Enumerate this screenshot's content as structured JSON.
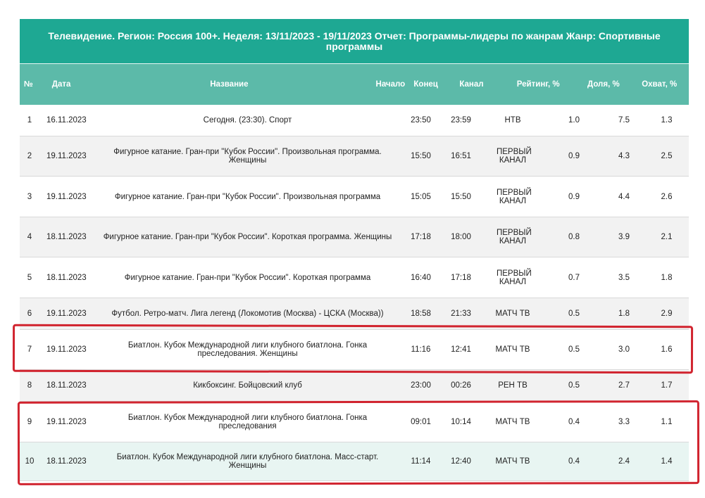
{
  "report": {
    "title": "Телевидение. Регион: Россия 100+. Неделя: 13/11/2023 - 19/11/2023 Отчет: Программы-лидеры по жанрам Жанр: Спортивные программы"
  },
  "columns": {
    "num": "№",
    "date": "Дата",
    "name": "Название",
    "start": "Начало",
    "end": "Конец",
    "channel": "Канал",
    "rating": "Рейтинг, %",
    "share": "Доля, %",
    "reach": "Охват, %"
  },
  "rows": [
    {
      "num": "1",
      "date": "16.11.2023",
      "name": "Сегодня. (23:30). Спорт",
      "start": "23:50",
      "end": "23:59",
      "channel": "НТВ",
      "rating": "1.0",
      "share": "7.5",
      "reach": "1.3"
    },
    {
      "num": "2",
      "date": "19.11.2023",
      "name": "Фигурное катание. Гран-при \"Кубок России\". Произвольная программа. Женщины",
      "start": "15:50",
      "end": "16:51",
      "channel": "ПЕРВЫЙ КАНАЛ",
      "rating": "0.9",
      "share": "4.3",
      "reach": "2.5"
    },
    {
      "num": "3",
      "date": "19.11.2023",
      "name": "Фигурное катание. Гран-при \"Кубок России\". Произвольная программа",
      "start": "15:05",
      "end": "15:50",
      "channel": "ПЕРВЫЙ КАНАЛ",
      "rating": "0.9",
      "share": "4.4",
      "reach": "2.6"
    },
    {
      "num": "4",
      "date": "18.11.2023",
      "name": "Фигурное катание. Гран-при \"Кубок России\". Короткая программа. Женщины",
      "start": "17:18",
      "end": "18:00",
      "channel": "ПЕРВЫЙ КАНАЛ",
      "rating": "0.8",
      "share": "3.9",
      "reach": "2.1"
    },
    {
      "num": "5",
      "date": "18.11.2023",
      "name": "Фигурное катание. Гран-при \"Кубок России\". Короткая программа",
      "start": "16:40",
      "end": "17:18",
      "channel": "ПЕРВЫЙ КАНАЛ",
      "rating": "0.7",
      "share": "3.5",
      "reach": "1.8"
    },
    {
      "num": "6",
      "date": "19.11.2023",
      "name": "Футбол. Ретро-матч. Лига легенд (Локомотив (Москва) - ЦСКА (Москва))",
      "start": "18:58",
      "end": "21:33",
      "channel": "МАТЧ ТВ",
      "rating": "0.5",
      "share": "1.8",
      "reach": "2.9"
    },
    {
      "num": "7",
      "date": "19.11.2023",
      "name": "Биатлон. Кубок Международной лиги клубного биатлона. Гонка преследования. Женщины",
      "start": "11:16",
      "end": "12:41",
      "channel": "МАТЧ ТВ",
      "rating": "0.5",
      "share": "3.0",
      "reach": "1.6"
    },
    {
      "num": "8",
      "date": "18.11.2023",
      "name": "Кикбоксинг. Бойцовский клуб",
      "start": "23:00",
      "end": "00:26",
      "channel": "РЕН ТВ",
      "rating": "0.5",
      "share": "2.7",
      "reach": "1.7"
    },
    {
      "num": "9",
      "date": "19.11.2023",
      "name": "Биатлон. Кубок Международной лиги клубного биатлона. Гонка преследования",
      "start": "09:01",
      "end": "10:14",
      "channel": "МАТЧ ТВ",
      "rating": "0.4",
      "share": "3.3",
      "reach": "1.1"
    },
    {
      "num": "10",
      "date": "18.11.2023",
      "name": "Биатлон. Кубок Международной лиги клубного биатлона. Масс-старт. Женщины",
      "start": "11:14",
      "end": "12:40",
      "channel": "МАТЧ ТВ",
      "rating": "0.4",
      "share": "2.4",
      "reach": "1.4"
    }
  ],
  "colors": {
    "title_bg": "#1ea893",
    "header_bg": "#5cbaa9",
    "highlight": "#d1242f"
  }
}
